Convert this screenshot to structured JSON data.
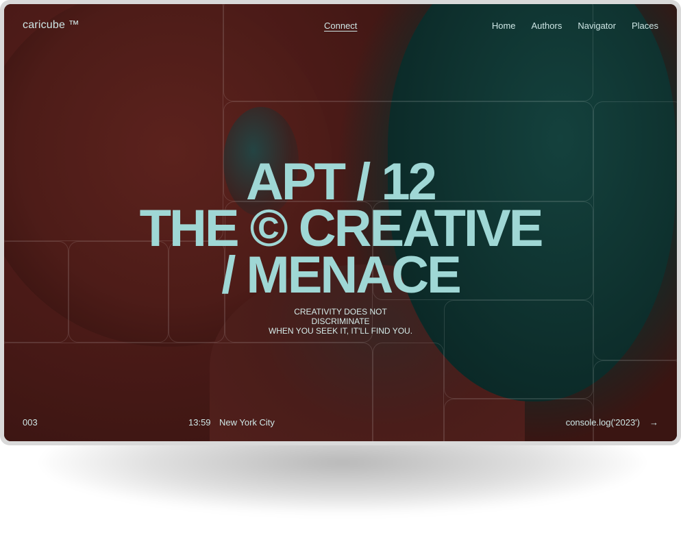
{
  "nav": {
    "logo": "caricube ™",
    "connect": "Connect",
    "menu": [
      "Home",
      "Authors",
      "Navigator",
      "Places"
    ]
  },
  "hero": {
    "line1": "APT / 12",
    "line2": "THE © CREATIVE",
    "line3": "/ MENACE",
    "tagline": [
      "CREATIVITY DOES NOT",
      "DISCRIMINATE",
      "WHEN YOU SEEK IT, IT'LL FIND YOU."
    ]
  },
  "footer": {
    "number": "003",
    "time": "13:59",
    "city": "New York City",
    "console": "console.log('2023')",
    "arrow_icon": "arrow-right-icon"
  },
  "colors": {
    "headline": "#9fd7d5",
    "red_tone": "#4a1b18",
    "teal_tone": "#0f3532"
  }
}
